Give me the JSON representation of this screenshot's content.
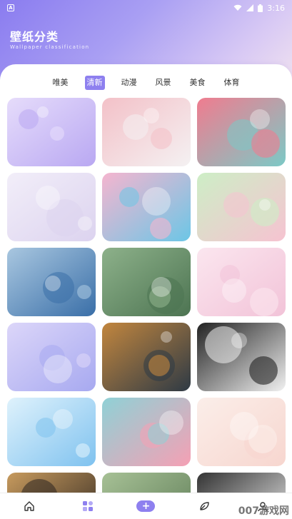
{
  "status_bar": {
    "notification_icon_label": "A",
    "time": "3:16"
  },
  "header": {
    "title": "壁纸分类",
    "subtitle": "Wallpaper classification"
  },
  "tabs": [
    {
      "label": "唯美",
      "active": false
    },
    {
      "label": "清新",
      "active": true
    },
    {
      "label": "动漫",
      "active": false
    },
    {
      "label": "风景",
      "active": false
    },
    {
      "label": "美食",
      "active": false
    },
    {
      "label": "体育",
      "active": false
    }
  ],
  "wallpapers": [
    {
      "name": "purple-balloons-wallpaper",
      "palette": [
        "#b9a8f2",
        "#e6dcfb"
      ]
    },
    {
      "name": "anime-girl-sketch-wallpaper",
      "palette": [
        "#f4f1f2",
        "#f3c1c8"
      ]
    },
    {
      "name": "fruit-platter-wallpaper",
      "palette": [
        "#7cc9c6",
        "#f07c8f"
      ]
    },
    {
      "name": "earphones-wallpaper",
      "palette": [
        "#dcd3ef",
        "#f2eef9"
      ]
    },
    {
      "name": "colorful-balloons-wallpaper",
      "palette": [
        "#6cc6e6",
        "#f5b5cf"
      ]
    },
    {
      "name": "marshmallows-wallpaper",
      "palette": [
        "#f6c3d1",
        "#cdeec6"
      ]
    },
    {
      "name": "anime-house-wallpaper",
      "palette": [
        "#3a6fa8",
        "#a9c7e0"
      ]
    },
    {
      "name": "forest-scene-wallpaper",
      "palette": [
        "#4d7452",
        "#8db18a"
      ]
    },
    {
      "name": "cherry-blossom-girl-wallpaper",
      "palette": [
        "#f2c3d8",
        "#fbe6ef"
      ]
    },
    {
      "name": "purple-sky-ladder-wallpaper",
      "palette": [
        "#a7a9f0",
        "#dcd6f9"
      ]
    },
    {
      "name": "cartoon-character-wallpaper",
      "palette": [
        "#2e3a45",
        "#c2863e"
      ]
    },
    {
      "name": "lineart-girl-wallpaper",
      "palette": [
        "#f1f1f1",
        "#222222"
      ]
    },
    {
      "name": "blue-sky-anime-wallpaper",
      "palette": [
        "#7fc2ef",
        "#dff2fc"
      ]
    },
    {
      "name": "watermelon-cookies-wallpaper",
      "palette": [
        "#f5a0b4",
        "#8fd1d6"
      ]
    },
    {
      "name": "ferris-wheel-wallpaper",
      "palette": [
        "#f7d6cf",
        "#fbeee9"
      ]
    },
    {
      "name": "dark-figure-wallpaper",
      "palette": [
        "#2b2420",
        "#c89b5e"
      ]
    },
    {
      "name": "green-scene-wallpaper",
      "palette": [
        "#5c7a55",
        "#a7c196"
      ]
    },
    {
      "name": "doodle-wallpaper",
      "palette": [
        "#f4f4f4",
        "#333333"
      ]
    }
  ],
  "bottom_nav": {
    "add_label": "+"
  },
  "watermark": {
    "text": "007游戏网",
    "url": "www.yx007.com"
  },
  "colors": {
    "accent": "#8e80ef",
    "header_gradient_start": "#8a7cf0",
    "header_gradient_end": "#f4e6ef"
  }
}
